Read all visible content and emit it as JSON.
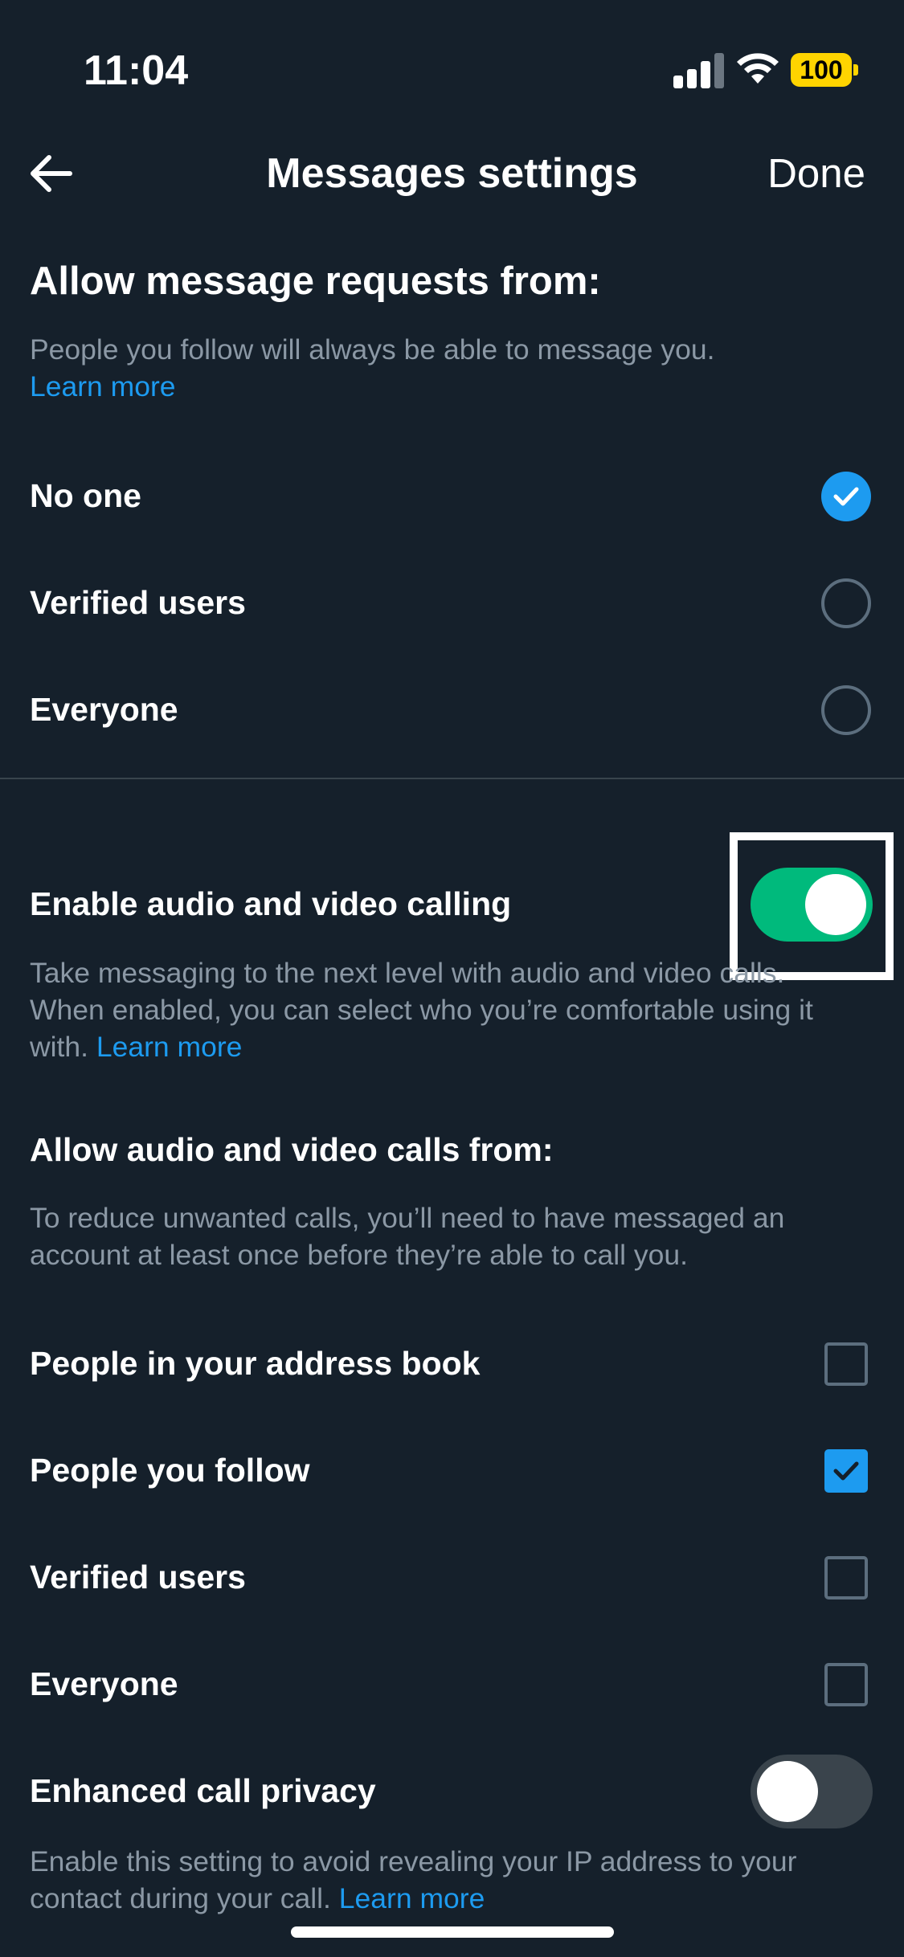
{
  "status_bar": {
    "time": "11:04",
    "battery": "100",
    "icons": [
      "signal-icon",
      "wifi-icon",
      "battery-icon"
    ]
  },
  "header": {
    "title": "Messages settings",
    "done_label": "Done",
    "back_icon": "arrow-left-icon"
  },
  "message_requests": {
    "title": "Allow message requests from:",
    "description": "People you follow will always be able to message you.",
    "learn_more": "Learn more",
    "options": [
      {
        "label": "No one",
        "checked": true
      },
      {
        "label": "Verified users",
        "checked": false
      },
      {
        "label": "Everyone",
        "checked": false
      }
    ]
  },
  "calling": {
    "title": "Enable audio and video calling",
    "enabled": true,
    "description": "Take messaging to the next level with audio and video calls. When enabled, you can select who you’re comfortable using it with.",
    "learn_more": "Learn more"
  },
  "calls_from": {
    "title": "Allow audio and video calls from:",
    "description": "To reduce unwanted calls, you’ll need to have messaged an account at least once before they’re able to call you.",
    "options": [
      {
        "label": "People in your address book",
        "checked": false
      },
      {
        "label": "People you follow",
        "checked": true
      },
      {
        "label": "Verified users",
        "checked": false
      },
      {
        "label": "Everyone",
        "checked": false
      }
    ]
  },
  "enhanced_privacy": {
    "title": "Enhanced call privacy",
    "enabled": false,
    "description": "Enable this setting to avoid revealing your IP address to your contact during your call.",
    "learn_more": "Learn more"
  },
  "colors": {
    "background": "#15202b",
    "accent": "#1d9bf0",
    "toggle_on": "#00ba7c",
    "secondary_text": "#8b98a5"
  }
}
